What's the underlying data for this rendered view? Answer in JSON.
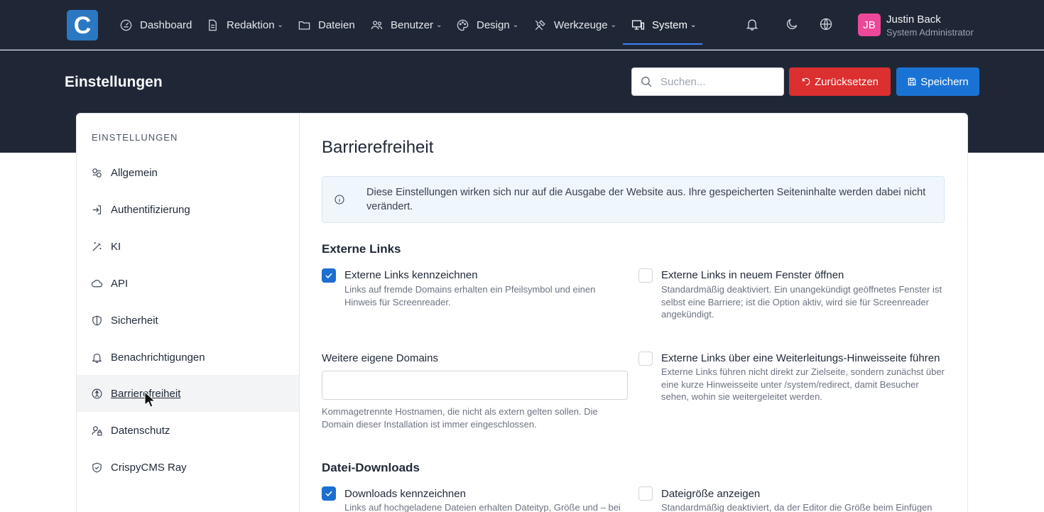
{
  "brand": {
    "logo_letter": "C"
  },
  "nav": {
    "items": [
      {
        "label": "Dashboard",
        "icon": "gauge-icon",
        "has_dropdown": false
      },
      {
        "label": "Redaktion",
        "icon": "document-icon",
        "has_dropdown": true
      },
      {
        "label": "Dateien",
        "icon": "folder-icon",
        "has_dropdown": false
      },
      {
        "label": "Benutzer",
        "icon": "users-icon",
        "has_dropdown": true
      },
      {
        "label": "Design",
        "icon": "palette-icon",
        "has_dropdown": true
      },
      {
        "label": "Werkzeuge",
        "icon": "tools-icon",
        "has_dropdown": true
      },
      {
        "label": "System",
        "icon": "devices-icon",
        "has_dropdown": true,
        "active": true
      }
    ],
    "chevron": "⌄"
  },
  "user": {
    "initials": "JB",
    "name": "Justin Back",
    "role": "System Administrator"
  },
  "header": {
    "title": "Einstellungen",
    "search_placeholder": "Suchen...",
    "reset_label": "Zurücksetzen",
    "save_label": "Speichern"
  },
  "colors": {
    "nav_bg": "#1f2737",
    "reset": "#dc2f2f",
    "save": "#1a73d4",
    "checkbox": "#1a6fd0",
    "avatar": "#ec4899"
  },
  "sidebar": {
    "heading": "EINSTELLUNGEN",
    "items": [
      {
        "label": "Allgemein",
        "icon": "settings-toggle-icon"
      },
      {
        "label": "Authentifizierung",
        "icon": "login-icon"
      },
      {
        "label": "KI",
        "icon": "magic-wand-icon"
      },
      {
        "label": "API",
        "icon": "cloud-icon"
      },
      {
        "label": "Sicherheit",
        "icon": "shield-icon"
      },
      {
        "label": "Benachrichtigungen",
        "icon": "bell-icon"
      },
      {
        "label": "Barrierefreiheit",
        "icon": "accessibility-icon",
        "active": true
      },
      {
        "label": "Datenschutz",
        "icon": "user-lock-icon"
      },
      {
        "label": "CrispyCMS Ray",
        "icon": "shield-check-icon"
      }
    ]
  },
  "main": {
    "title": "Barrierefreiheit",
    "info": "Diese Einstellungen wirken sich nur auf die Ausgabe der Website aus. Ihre gespeicherten Seiteninhalte werden dabei nicht verändert.",
    "sections": {
      "external": {
        "title": "Externe Links",
        "mark": {
          "label": "Externe Links kennzeichnen",
          "desc": "Links auf fremde Domains erhalten ein Pfeilsymbol und einen Hinweis für Screenreader.",
          "checked": true
        },
        "new_window": {
          "label": "Externe Links in neuem Fenster öffnen",
          "desc": "Standardmäßig deaktiviert. Ein unangekündigt geöffnetes Fenster ist selbst eine Barriere; ist die Option aktiv, wird sie für Screenreader angekündigt.",
          "checked": false
        },
        "domains": {
          "label": "Weitere eigene Domains",
          "value": "",
          "help": "Kommagetrennte Hostnamen, die nicht als extern gelten sollen. Die Domain dieser Installation ist immer eingeschlossen."
        },
        "redirect": {
          "label": "Externe Links über eine Weiterleitungs-Hinweisseite führen",
          "desc": "Externe Links führen nicht direkt zur Zielseite, sondern zunächst über eine kurze Hinweisseite unter /system/redirect, damit Besucher sehen, wohin sie weitergeleitet werden.",
          "checked": false
        }
      },
      "downloads": {
        "title": "Datei-Downloads",
        "mark": {
          "label": "Downloads kennzeichnen",
          "desc": "Links auf hochgeladene Dateien erhalten Dateityp, Größe und – bei",
          "checked": true
        },
        "size": {
          "label": "Dateigröße anzeigen",
          "desc": "Standardmäßig deaktiviert, da der Editor die Größe beim Einfügen",
          "checked": false
        }
      }
    }
  }
}
